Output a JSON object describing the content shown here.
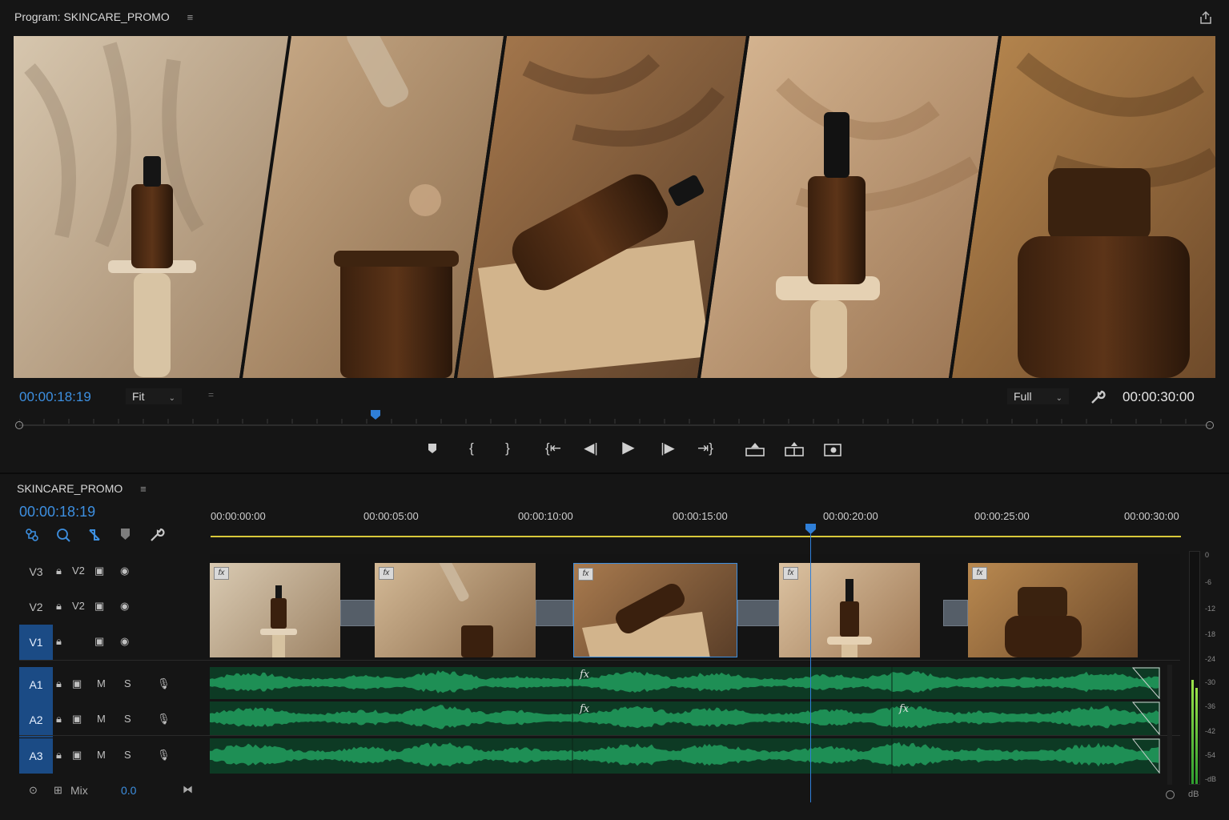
{
  "program": {
    "title": "Program: SKINCARE_PROMO",
    "menu_icon": "≡",
    "timecode": "00:00:18:19",
    "fit_label": "Fit",
    "quality_label": "Full",
    "duration": "00:00:30:00",
    "colors": {
      "timecode": "#3d8fe0",
      "playhead": "#2f7fd8"
    }
  },
  "timeline": {
    "sequence_name": "SKINCARE_PROMO",
    "menu_icon": "≡",
    "timecode": "00:00:18:19",
    "ruler": [
      "00:00:00:00",
      "00:00:05:00",
      "00:00:10:00",
      "00:00:15:00",
      "00:00:20:00",
      "00:00:25:00",
      "00:00:30:00"
    ],
    "video_tracks": [
      {
        "label": "V3",
        "source": "V2"
      },
      {
        "label": "V2",
        "source": "V2"
      },
      {
        "label": "V1",
        "source": ""
      }
    ],
    "audio_tracks": [
      {
        "label": "A1",
        "mute": "M",
        "solo": "S"
      },
      {
        "label": "A2",
        "mute": "M",
        "solo": "S"
      },
      {
        "label": "A3",
        "mute": "M",
        "solo": "S"
      }
    ],
    "mix_label": "Mix",
    "mix_value": "0.0",
    "fx_badge": "fx",
    "meter_scale": [
      "0",
      "-6",
      "-12",
      "-18",
      "-24",
      "-30",
      "-36",
      "-42",
      "-54",
      "-dB"
    ],
    "meter_unit": "dB",
    "colors": {
      "active_track": "#1b4b85",
      "audio_wave": "#1e8f55",
      "playhead": "#2f7fd8",
      "work_area": "#d8c83a"
    }
  }
}
